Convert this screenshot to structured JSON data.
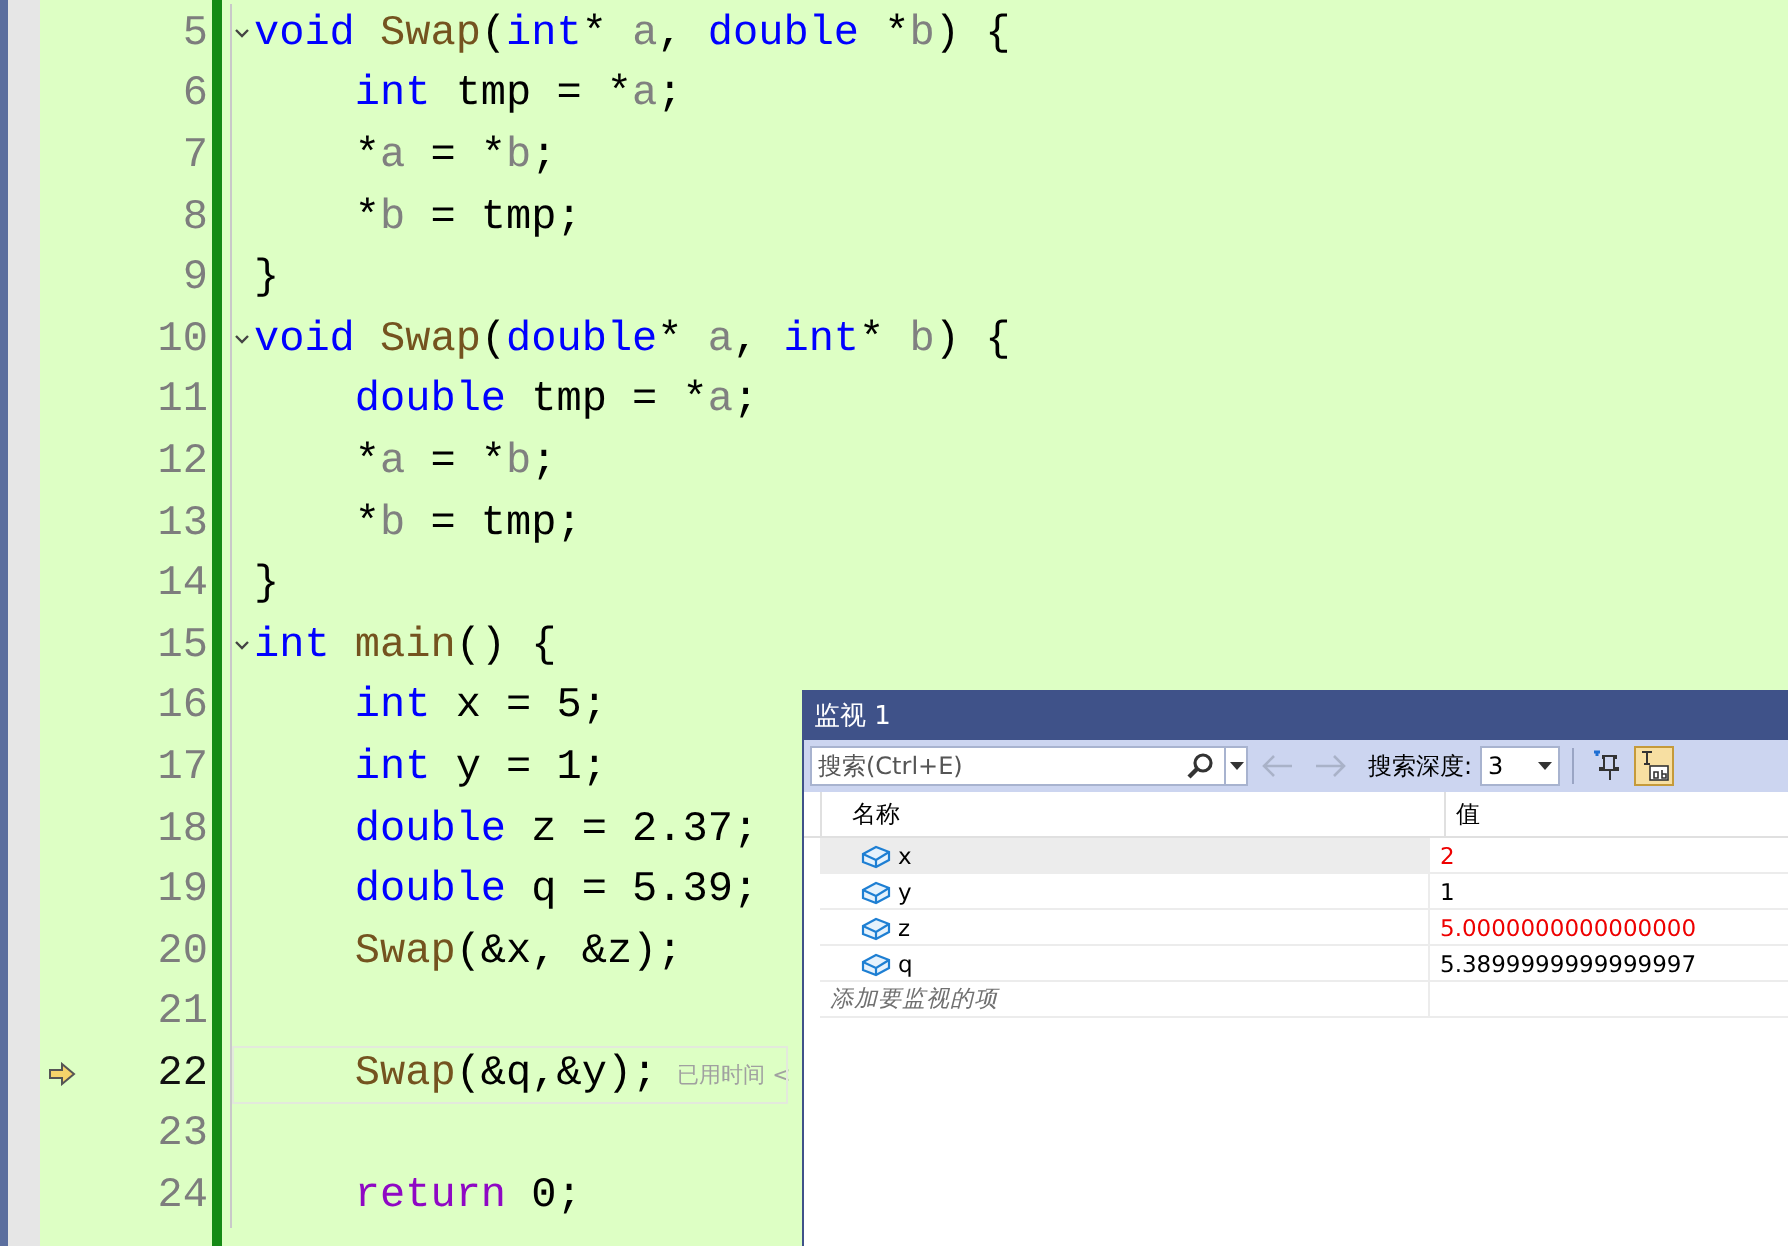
{
  "editor": {
    "lines": [
      {
        "number": "5",
        "foldable": true,
        "current": false,
        "tokens": [
          {
            "t": "void",
            "kind": "kw"
          },
          {
            "t": " Swap",
            "kind": "fn"
          },
          {
            "t": "(",
            "kind": "text"
          },
          {
            "t": "int",
            "kind": "kw"
          },
          {
            "t": "* ",
            "kind": "text"
          },
          {
            "t": "a",
            "kind": "param"
          },
          {
            "t": ", ",
            "kind": "text"
          },
          {
            "t": "double",
            "kind": "kw"
          },
          {
            "t": " *",
            "kind": "text"
          },
          {
            "t": "b",
            "kind": "param"
          },
          {
            "t": ") {",
            "kind": "text"
          }
        ]
      },
      {
        "number": "6",
        "foldable": false,
        "current": false,
        "tokens": [
          {
            "t": "    int",
            "kind": "kw"
          },
          {
            "t": " tmp = *",
            "kind": "text"
          },
          {
            "t": "a",
            "kind": "param"
          },
          {
            "t": ";",
            "kind": "text"
          }
        ]
      },
      {
        "number": "7",
        "foldable": false,
        "current": false,
        "tokens": [
          {
            "t": "    *",
            "kind": "text"
          },
          {
            "t": "a",
            "kind": "param"
          },
          {
            "t": " = *",
            "kind": "text"
          },
          {
            "t": "b",
            "kind": "param"
          },
          {
            "t": ";",
            "kind": "text"
          }
        ]
      },
      {
        "number": "8",
        "foldable": false,
        "current": false,
        "tokens": [
          {
            "t": "    *",
            "kind": "text"
          },
          {
            "t": "b",
            "kind": "param"
          },
          {
            "t": " = tmp;",
            "kind": "text"
          }
        ]
      },
      {
        "number": "9",
        "foldable": false,
        "current": false,
        "tokens": [
          {
            "t": "}",
            "kind": "text"
          }
        ]
      },
      {
        "number": "10",
        "foldable": true,
        "current": false,
        "tokens": [
          {
            "t": "void",
            "kind": "kw"
          },
          {
            "t": " Swap",
            "kind": "fn"
          },
          {
            "t": "(",
            "kind": "text"
          },
          {
            "t": "double",
            "kind": "kw"
          },
          {
            "t": "* ",
            "kind": "text"
          },
          {
            "t": "a",
            "kind": "param"
          },
          {
            "t": ", ",
            "kind": "text"
          },
          {
            "t": "int",
            "kind": "kw"
          },
          {
            "t": "* ",
            "kind": "text"
          },
          {
            "t": "b",
            "kind": "param"
          },
          {
            "t": ") {",
            "kind": "text"
          }
        ]
      },
      {
        "number": "11",
        "foldable": false,
        "current": false,
        "tokens": [
          {
            "t": "    double",
            "kind": "kw"
          },
          {
            "t": " tmp = *",
            "kind": "text"
          },
          {
            "t": "a",
            "kind": "param"
          },
          {
            "t": ";",
            "kind": "text"
          }
        ]
      },
      {
        "number": "12",
        "foldable": false,
        "current": false,
        "tokens": [
          {
            "t": "    *",
            "kind": "text"
          },
          {
            "t": "a",
            "kind": "param"
          },
          {
            "t": " = *",
            "kind": "text"
          },
          {
            "t": "b",
            "kind": "param"
          },
          {
            "t": ";",
            "kind": "text"
          }
        ]
      },
      {
        "number": "13",
        "foldable": false,
        "current": false,
        "tokens": [
          {
            "t": "    *",
            "kind": "text"
          },
          {
            "t": "b",
            "kind": "param"
          },
          {
            "t": " = tmp;",
            "kind": "text"
          }
        ]
      },
      {
        "number": "14",
        "foldable": false,
        "current": false,
        "tokens": [
          {
            "t": "}",
            "kind": "text"
          }
        ]
      },
      {
        "number": "15",
        "foldable": true,
        "current": false,
        "tokens": [
          {
            "t": "int",
            "kind": "kw"
          },
          {
            "t": " main",
            "kind": "fn"
          },
          {
            "t": "() {",
            "kind": "text"
          }
        ]
      },
      {
        "number": "16",
        "foldable": false,
        "current": false,
        "tokens": [
          {
            "t": "    int",
            "kind": "kw"
          },
          {
            "t": " x = 5;",
            "kind": "text"
          }
        ]
      },
      {
        "number": "17",
        "foldable": false,
        "current": false,
        "tokens": [
          {
            "t": "    int",
            "kind": "kw"
          },
          {
            "t": " y = 1;",
            "kind": "text"
          }
        ]
      },
      {
        "number": "18",
        "foldable": false,
        "current": false,
        "tokens": [
          {
            "t": "    double",
            "kind": "kw"
          },
          {
            "t": " z = 2.37;",
            "kind": "text"
          }
        ]
      },
      {
        "number": "19",
        "foldable": false,
        "current": false,
        "tokens": [
          {
            "t": "    double",
            "kind": "kw"
          },
          {
            "t": " q = 5.39;",
            "kind": "text"
          }
        ]
      },
      {
        "number": "20",
        "foldable": false,
        "current": false,
        "tokens": [
          {
            "t": "    Swap",
            "kind": "fn"
          },
          {
            "t": "(&x, &z);",
            "kind": "text"
          }
        ]
      },
      {
        "number": "21",
        "foldable": false,
        "current": false
      },
      {
        "number": "22",
        "foldable": false,
        "current": true,
        "hint": "已用时间 <",
        "tokens": [
          {
            "t": "    Swap",
            "kind": "fn"
          },
          {
            "t": "(&q,&y);",
            "kind": "text"
          }
        ]
      },
      {
        "number": "23",
        "foldable": false,
        "current": false
      },
      {
        "number": "24",
        "foldable": false,
        "current": false,
        "tokens": [
          {
            "t": "    return",
            "kind": "ctl"
          },
          {
            "t": " 0;",
            "kind": "text"
          }
        ]
      }
    ]
  },
  "watch": {
    "title": "监视 1",
    "search": {
      "placeholder": "搜索(Ctrl+E)"
    },
    "back_disabled": true,
    "forward_disabled": true,
    "depth_label": "搜索深度:",
    "depth": "3",
    "hex_selected": true,
    "columns": [
      "名称",
      "值"
    ],
    "rows": [
      {
        "name": "x",
        "value": "2",
        "changed": true,
        "selected": true
      },
      {
        "name": "y",
        "value": "1",
        "changed": false,
        "selected": false
      },
      {
        "name": "z",
        "value": "5.0000000000000000",
        "changed": true,
        "selected": false
      },
      {
        "name": "q",
        "value": "5.3899999999999997",
        "changed": false,
        "selected": false
      }
    ],
    "add_placeholder": "添加要监视的项"
  }
}
